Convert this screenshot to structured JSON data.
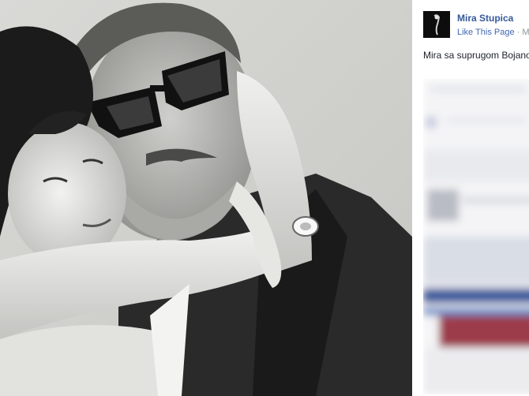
{
  "page": {
    "name": "Mira Stupica",
    "like_label": "Like This Page",
    "separator": " · ",
    "date": "Ma"
  },
  "post": {
    "caption": "Mira sa suprugom Bojano"
  },
  "photo": {
    "description_icon": "black-and-white-photo"
  },
  "colors": {
    "link_blue": "#365899",
    "like_blue": "#4267b2",
    "muted": "#90949c",
    "text": "#1d2129"
  }
}
